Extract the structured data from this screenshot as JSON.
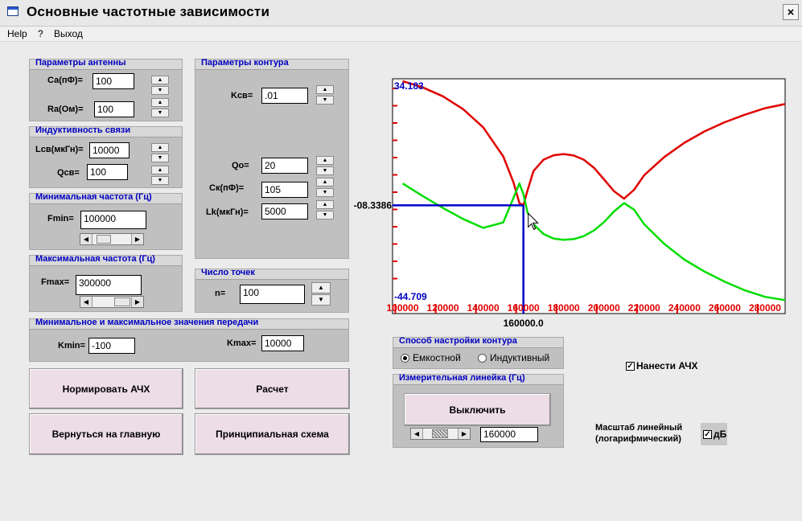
{
  "window": {
    "title": "Основные частотные зависимости",
    "close": "×"
  },
  "menu": [
    "Help",
    "?",
    "Выход"
  ],
  "antenna": {
    "title": "Параметры антенны",
    "ca_label": "Са(пФ)=",
    "ca_value": "100",
    "ra_label": "Ra(Ом)=",
    "ra_value": "100"
  },
  "coupling": {
    "title": "Индуктивность связи",
    "lcv_label": "Lсв(мкГн)=",
    "lcv_value": "10000",
    "qcv_label": "Qсв=",
    "qcv_value": "100"
  },
  "fmin": {
    "title": "Минимальная частота (Гц)",
    "label": "Fmin=",
    "value": "100000"
  },
  "fmax": {
    "title": "Максимальная частота (Гц)",
    "label": "Fmax=",
    "value": "300000"
  },
  "contour": {
    "title": "Параметры контура",
    "kcv_label": "Kсв=",
    "kcv_value": ".01",
    "qo_label": "Qo=",
    "qo_value": "20",
    "ck_label": "Ск(пФ)=",
    "ck_value": "105",
    "lk_label": "Lk(мкГн)=",
    "lk_value": "5000"
  },
  "points": {
    "title": "Число точек",
    "label": "n=",
    "value": "100"
  },
  "transfer": {
    "title": "Минимальное и максимальное значения передачи",
    "kmin_label": "Kmin=",
    "kmin_value": "-100",
    "kmax_label": "Kmax=",
    "kmax_value": "10000"
  },
  "buttons": {
    "normalize": "Нормировать АЧХ",
    "calculate": "Расчет",
    "back": "Вернуться на главную",
    "schematic": "Принципиальная схема"
  },
  "tuning": {
    "title": "Способ настройки контура",
    "capacitive": "Емкостной",
    "inductive": "Индуктивный",
    "selected": "capacitive"
  },
  "ruler": {
    "title": "Измерительная линейка (Гц)",
    "button": "Выключить",
    "value": "160000"
  },
  "plot_afc": {
    "label": "Нанести АЧХ",
    "checked": true
  },
  "scale": {
    "label_line1": "Масштаб линейный",
    "label_line2": "(логарифмический)",
    "db_label": "дБ",
    "checked": true
  },
  "chart_data": {
    "type": "line",
    "ylim": [
      -44.709,
      34.183
    ],
    "xlim": [
      100000,
      290000
    ],
    "y_max_label": "34.183",
    "y_min_label": "-44.709",
    "x_tick_labels": [
      "100000",
      "120000",
      "140000",
      "160000",
      "180000",
      "200000",
      "220000",
      "240000",
      "260000",
      "280000"
    ],
    "x_ticks": [
      100000,
      120000,
      140000,
      160000,
      180000,
      200000,
      220000,
      240000,
      260000,
      280000
    ],
    "cursor": {
      "x": 160000,
      "x_label": "160000.0",
      "y": -8.3386,
      "y_label": "-08.3386"
    },
    "colors": {
      "series1": "#e00000",
      "series2": "#00dd00",
      "cursor": "#0000c8",
      "ticks": "#e00000",
      "labels_y": "#0000c0"
    },
    "series": [
      {
        "color": "#e00000",
        "x": [
          100000,
          110000,
          120000,
          130000,
          140000,
          150000,
          155000,
          158000,
          160000,
          162000,
          165000,
          170000,
          175000,
          180000,
          185000,
          190000,
          195000,
          200000,
          205000,
          210000,
          215000,
          220000,
          230000,
          240000,
          250000,
          260000,
          270000,
          280000,
          290000
        ],
        "y": [
          33.4,
          31.3,
          28.3,
          24.0,
          17.9,
          8.1,
          -0.5,
          -7.6,
          -8.3,
          -3.4,
          3.2,
          7.0,
          8.5,
          8.9,
          8.4,
          7.0,
          4.3,
          0.4,
          -3.6,
          -6.1,
          -3.1,
          1.8,
          7.9,
          12.7,
          16.5,
          19.6,
          22.1,
          24.3,
          25.7
        ]
      },
      {
        "color": "#00dd00",
        "x": [
          100000,
          110000,
          120000,
          130000,
          140000,
          150000,
          155000,
          158000,
          160000,
          162000,
          165000,
          170000,
          175000,
          180000,
          185000,
          190000,
          195000,
          200000,
          205000,
          210000,
          215000,
          220000,
          230000,
          240000,
          250000,
          260000,
          270000,
          280000,
          290000
        ],
        "y": [
          -1.0,
          -5.2,
          -9.2,
          -12.9,
          -15.9,
          -14.1,
          -5.9,
          -1.0,
          -4.6,
          -10.7,
          -14.7,
          -18.0,
          -19.5,
          -19.9,
          -19.7,
          -18.7,
          -16.8,
          -14.0,
          -10.4,
          -7.6,
          -9.8,
          -14.7,
          -21.3,
          -26.6,
          -30.6,
          -34.0,
          -36.9,
          -39.1,
          -40.2
        ]
      }
    ]
  }
}
